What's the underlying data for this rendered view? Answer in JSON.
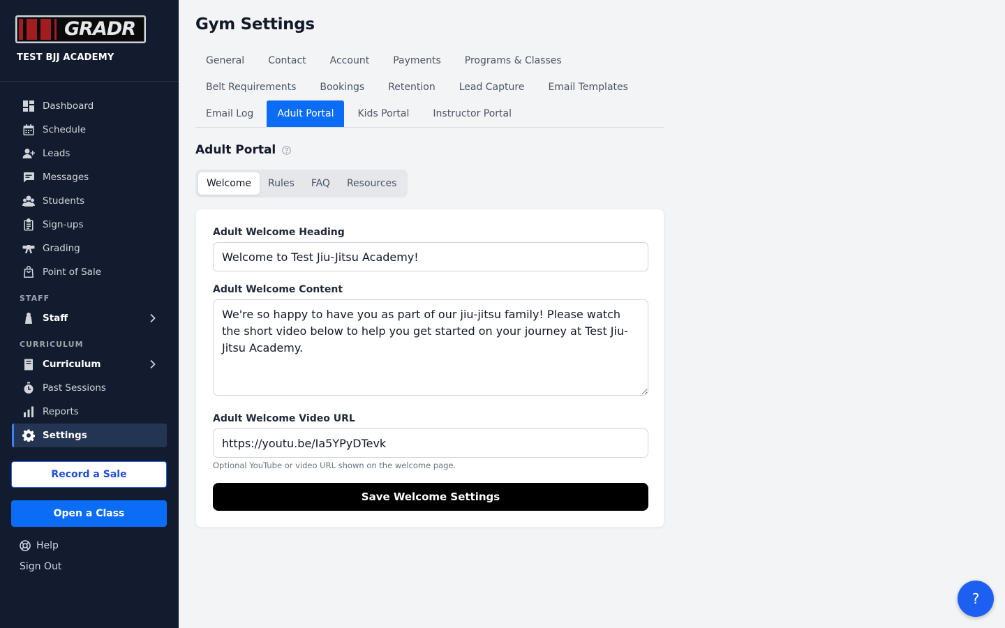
{
  "brand": {
    "logo_text": "GRADR",
    "gym_name": "TEST BJJ ACADEMY"
  },
  "sidebar": {
    "items": [
      {
        "label": "Dashboard",
        "icon": "dashboard-icon"
      },
      {
        "label": "Schedule",
        "icon": "calendar-icon"
      },
      {
        "label": "Leads",
        "icon": "add-user-icon"
      },
      {
        "label": "Messages",
        "icon": "chat-icon"
      },
      {
        "label": "Students",
        "icon": "students-icon"
      },
      {
        "label": "Sign-ups",
        "icon": "clipboard-icon"
      },
      {
        "label": "Grading",
        "icon": "belt-icon"
      },
      {
        "label": "Point of Sale",
        "icon": "shopping-bag-icon"
      }
    ],
    "staff_section": "STAFF",
    "staff_item": "Staff",
    "curriculum_section": "CURRICULUM",
    "curriculum_item": "Curriculum",
    "past_sessions": "Past Sessions",
    "reports": "Reports",
    "settings": "Settings",
    "record_sale": "Record a Sale",
    "open_class": "Open a Class",
    "help": "Help",
    "sign_out": "Sign Out"
  },
  "page": {
    "title": "Gym Settings",
    "tabs_row1": [
      "General",
      "Contact",
      "Account",
      "Payments",
      "Programs & Classes"
    ],
    "tabs_row2": [
      "Belt Requirements",
      "Bookings",
      "Retention",
      "Lead Capture",
      "Email Templates"
    ],
    "tabs_row3": [
      "Email Log",
      "Adult Portal",
      "Kids Portal",
      "Instructor Portal"
    ],
    "active_tab": "Adult Portal",
    "section_title": "Adult Portal",
    "subtabs": [
      "Welcome",
      "Rules",
      "FAQ",
      "Resources"
    ],
    "active_subtab": "Welcome"
  },
  "form": {
    "heading_label": "Adult Welcome Heading",
    "heading_value": "Welcome to Test Jiu-Jitsu Academy!",
    "content_label": "Adult Welcome Content",
    "content_value": "We're so happy to have you as part of our jiu-jitsu family! Please watch the short video below to help you get started on your journey at Test Jiu-Jitsu Academy.",
    "video_label": "Adult Welcome Video URL",
    "video_value": "https://youtu.be/Ia5YPyDTevk",
    "video_hint": "Optional YouTube or video URL shown on the welcome page.",
    "save_label": "Save Welcome Settings"
  },
  "help_fab": "?",
  "colors": {
    "sidebar_bg": "#131c2e",
    "accent": "#0b6cf5",
    "save_button": "#000000"
  }
}
